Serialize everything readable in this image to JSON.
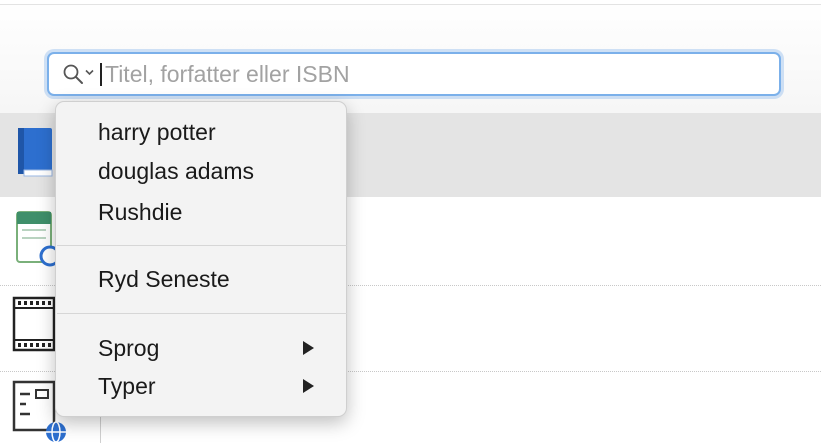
{
  "search": {
    "placeholder": "Titel, forfatter eller ISBN",
    "value": "",
    "focus_color": "#7bb0ea"
  },
  "menu": {
    "recent_searches": [
      "harry potter",
      "douglas adams",
      "Rushdie"
    ],
    "clear_recent_label": "Ryd Seneste",
    "submenus": [
      {
        "label": "Sprog",
        "icon": "submenu-arrow-icon"
      },
      {
        "label": "Typer",
        "icon": "submenu-arrow-icon"
      }
    ]
  },
  "rows": [
    {
      "icon": "book-icon"
    },
    {
      "icon": "calendar-icon"
    },
    {
      "icon": "film-icon"
    },
    {
      "icon": "web-form-icon"
    }
  ],
  "colors": {
    "selected_band": "#e4e4e4",
    "book_blue": "#2d6fcf",
    "menu_bg": "#f3f3f3"
  }
}
